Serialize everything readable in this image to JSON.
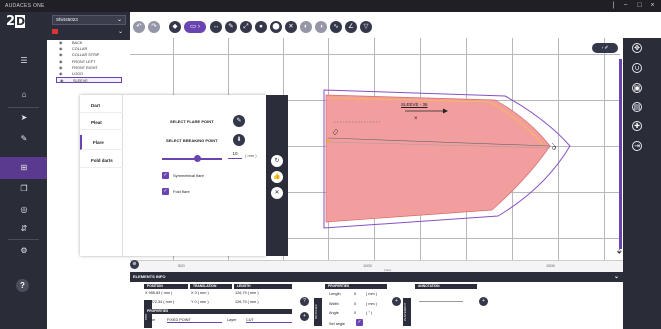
{
  "window": {
    "title": "AUDACES ONE",
    "controls": [
      "|",
      "−",
      "□",
      "×"
    ]
  },
  "app": {
    "logo_text": "2",
    "logo_box": "D"
  },
  "model": {
    "selected": "Shirt45023",
    "piece_group": ""
  },
  "pieces": [
    {
      "label": "BACK"
    },
    {
      "label": "COLLAR"
    },
    {
      "label": "COLLAR STRIP"
    },
    {
      "label": "FRONT LEFT"
    },
    {
      "label": "FRONT RIGHT"
    },
    {
      "label": "LOGO"
    },
    {
      "label": "SLEEVE",
      "selected": true
    }
  ],
  "flare": {
    "tabs": [
      "Dart",
      "Pleat",
      "Flare",
      "Fold darts"
    ],
    "active_tab": "Flare",
    "select_flare": "SELECT FLARE POINT",
    "select_breaking": "SELECT BREAKING POINT",
    "amount": "10",
    "unit": "( mm )",
    "slider_value": 0.6,
    "symmetrical": "Symmetrical flare",
    "fold_flare": "Fold flare"
  },
  "canvas": {
    "piece_label": "SLEEVE - 36"
  },
  "ruler": {
    "ticks": [
      "500",
      "1000",
      "1500"
    ],
    "unit": "(mm)"
  },
  "info": {
    "title": "ELEMENTS INFO",
    "position": {
      "head": "POSITION",
      "x": "X  955,83  ( mm )",
      "y": "Y  1072,34  ( mm )"
    },
    "translation": {
      "head": "TRANSLATION",
      "x": "X  0   ( mm )",
      "y": "Y  0   ( mm )"
    },
    "length": {
      "head": "LENGTH",
      "a": "126,79  ( mm )",
      "b": "126,79  ( mm )"
    },
    "properties_head": "PROPERTIES",
    "type_label": "Type",
    "type_value": "FIXED POINT",
    "layer_label": "Layer",
    "layer_value": "CUT",
    "points_tag": "POINTS",
    "notches_tag": "NOTCHES",
    "props2": {
      "head": "PROPERTIES",
      "length": "Length",
      "length_val": "5",
      "length_unit": "( mm )",
      "width": "Width",
      "width_val": "0",
      "width_unit": "( mm )",
      "angle": "Angle",
      "angle_val": "0",
      "angle_unit": "( ° )",
      "set_angle": "Set angle"
    },
    "placement_tag": "PLACEMENT",
    "annotation_head": "ANNOTATION"
  }
}
